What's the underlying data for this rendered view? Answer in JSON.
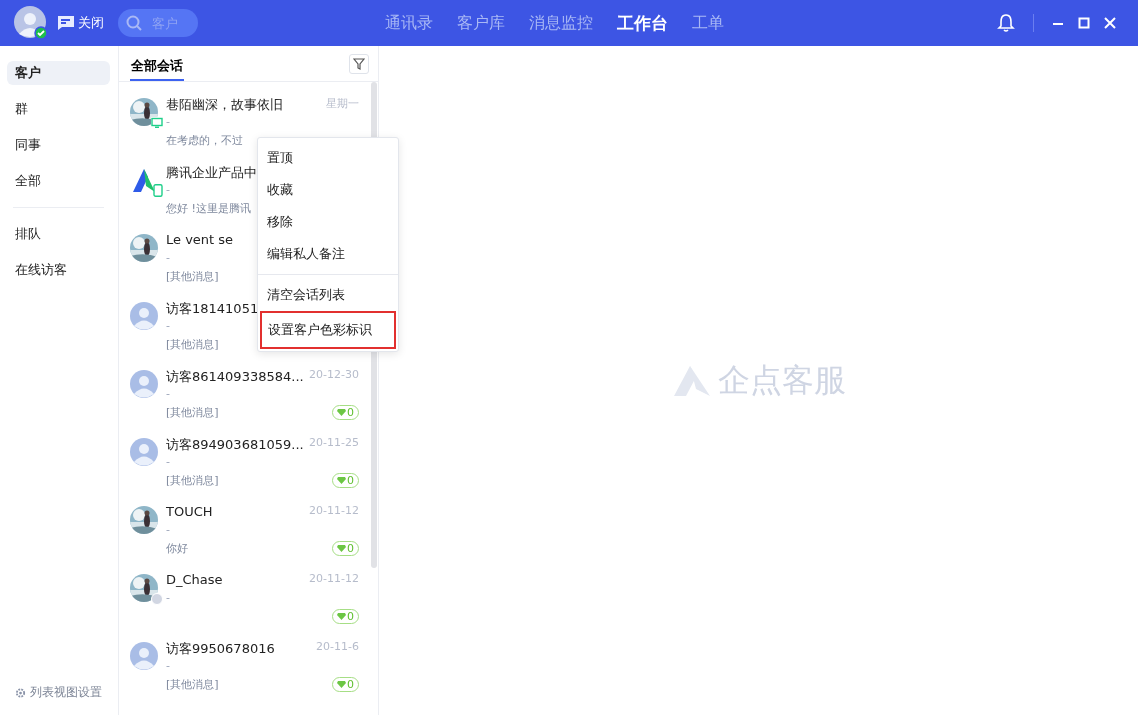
{
  "top_bar": {
    "close_label": "关闭",
    "search": {
      "placeholder": "客户"
    },
    "nav": [
      {
        "label": "通讯录",
        "selected": false
      },
      {
        "label": "客户库",
        "selected": false
      },
      {
        "label": "消息监控",
        "selected": false
      },
      {
        "label": "工作台",
        "selected": true
      },
      {
        "label": "工单",
        "selected": false
      }
    ]
  },
  "sidebar": {
    "items": [
      {
        "label": "客户",
        "selected": true
      },
      {
        "label": "群",
        "selected": false
      },
      {
        "label": "同事",
        "selected": false
      },
      {
        "label": "全部",
        "selected": false
      },
      {
        "kind": "divider"
      },
      {
        "label": "排队",
        "selected": false
      },
      {
        "label": "在线访客",
        "selected": false
      }
    ],
    "footer": "列表视图设置"
  },
  "conversations": {
    "tab": "全部会话",
    "rows": [
      {
        "status_icon": {
          "kind": "desktop"
        },
        "name": "巷陌幽深，故事依旧",
        "date": "星期一",
        "subtitle": "-",
        "message": "在考虑的，不过"
      },
      {
        "avatar": {
          "kind": "logo"
        },
        "status_icon": {
          "kind": "mobile"
        },
        "name": "腾讯企业产品中",
        "subtitle": "-",
        "message": "您好 !这里是腾讯"
      },
      {
        "name": "Le vent se",
        "subtitle": "-",
        "message": "[其他消息]"
      },
      {
        "avatar": {
          "kind": "default"
        },
        "name": "访客18141051",
        "subtitle": "-",
        "message": "[其他消息]"
      },
      {
        "avatar": {
          "kind": "default"
        },
        "name": "访客861409338584...",
        "date": "20-12-30",
        "subtitle": "-",
        "message": "[其他消息]",
        "badge": "0"
      },
      {
        "avatar": {
          "kind": "default"
        },
        "name": "访客894903681059...",
        "date": "20-11-25",
        "subtitle": "-",
        "message": "[其他消息]",
        "badge": "0"
      },
      {
        "name": "TOUCH",
        "date": "20-11-12",
        "subtitle": "-",
        "message": "你好",
        "badge": "0"
      },
      {
        "status_icon": {
          "kind": "offline"
        },
        "name": "D_Chase",
        "date": "20-11-12",
        "subtitle": "-",
        "badge": "0"
      },
      {
        "avatar": {
          "kind": "default"
        },
        "name": "访客9950678016",
        "date": "20-11-6",
        "subtitle": "-",
        "message": "[其他消息]",
        "badge": "0"
      }
    ]
  },
  "context_menu": {
    "items": [
      {
        "label": "置顶",
        "highlighted": false
      },
      {
        "label": "收藏",
        "highlighted": false
      },
      {
        "label": "移除",
        "highlighted": false
      },
      {
        "label": "编辑私人备注",
        "highlighted": false
      },
      {
        "kind": "divider"
      },
      {
        "label": "清空会话列表",
        "highlighted": false
      },
      {
        "label": "设置客户色彩标识",
        "highlighted": true
      }
    ]
  },
  "watermark": "企点客服"
}
